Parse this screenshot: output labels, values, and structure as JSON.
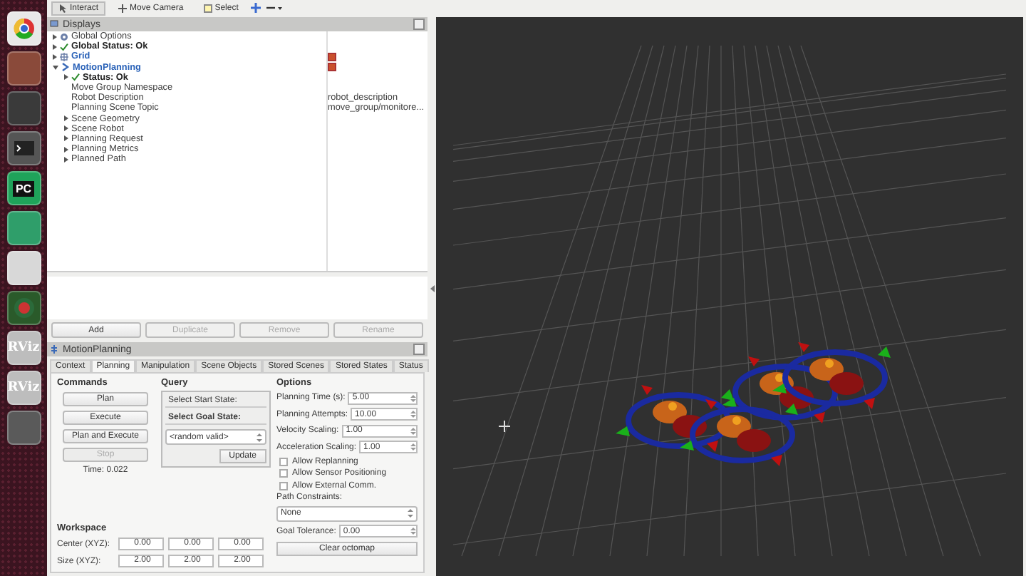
{
  "launcher": [
    {
      "kind": "chrome"
    },
    {
      "kind": "files"
    },
    {
      "kind": "settings"
    },
    {
      "kind": "terminal"
    },
    {
      "kind": "pycharm",
      "label": "PC"
    },
    {
      "kind": "green-app"
    },
    {
      "kind": "editor"
    },
    {
      "kind": "globe"
    },
    {
      "kind": "rviz",
      "label": "RViz"
    },
    {
      "kind": "rviz",
      "label": "RViz"
    },
    {
      "kind": "workspaces"
    }
  ],
  "toolbar": {
    "tools": [
      {
        "kind": "interact",
        "label": "Interact",
        "selected": true
      },
      {
        "kind": "camera",
        "label": "Move Camera",
        "selected": false
      },
      {
        "kind": "select",
        "label": "Select",
        "selected": false
      }
    ]
  },
  "displays": {
    "title": "Displays",
    "items": [
      {
        "label": "Global Options",
        "kind": "options",
        "expanded": false
      },
      {
        "label": "Global Status: Ok",
        "kind": "status",
        "expanded": false
      },
      {
        "label": "Grid",
        "kind": "grid",
        "expanded": false,
        "checked": true
      },
      {
        "label": "MotionPlanning",
        "kind": "plugin",
        "expanded": true,
        "checked": true,
        "children": [
          {
            "label": "Status: Ok",
            "kind": "status",
            "expanded": false
          },
          {
            "label": "Move Group Namespace",
            "kind": "property"
          },
          {
            "label": "Robot Description",
            "kind": "property",
            "value": "robot_description"
          },
          {
            "label": "Planning Scene Topic",
            "kind": "property",
            "value": "move_group/monitore..."
          },
          {
            "label": "Scene Geometry",
            "kind": "group",
            "expanded": false
          },
          {
            "label": "Scene Robot",
            "kind": "group",
            "expanded": false
          },
          {
            "label": "Planning Request",
            "kind": "group",
            "expanded": false
          },
          {
            "label": "Planning Metrics",
            "kind": "group",
            "expanded": false
          },
          {
            "label": "Planned Path",
            "kind": "group",
            "expanded": false
          }
        ]
      }
    ],
    "buttons": [
      {
        "label": "Add",
        "disabled": false
      },
      {
        "label": "Duplicate",
        "disabled": true
      },
      {
        "label": "Remove",
        "disabled": true
      },
      {
        "label": "Rename",
        "disabled": true
      }
    ]
  },
  "motion_planning": {
    "title": "MotionPlanning",
    "tabs": [
      {
        "label": "Context",
        "selected": false
      },
      {
        "label": "Planning",
        "selected": true
      },
      {
        "label": "Manipulation",
        "selected": false
      },
      {
        "label": "Scene Objects",
        "selected": false
      },
      {
        "label": "Stored Scenes",
        "selected": false
      },
      {
        "label": "Stored States",
        "selected": false
      },
      {
        "label": "Status",
        "selected": false
      }
    ],
    "commands": {
      "title": "Commands",
      "buttons": [
        {
          "label": "Plan",
          "disabled": false
        },
        {
          "label": "Execute",
          "disabled": false
        },
        {
          "label": "Plan and Execute",
          "disabled": false
        },
        {
          "label": "Stop",
          "disabled": true
        }
      ],
      "time": "Time: 0.022"
    },
    "query": {
      "title": "Query",
      "sections": [
        {
          "label": "Select Start State:",
          "expanded": false
        },
        {
          "label": "Select Goal State:",
          "expanded": true
        }
      ],
      "goal_state": "<random valid>",
      "update_button": "Update"
    },
    "workspace": {
      "title": "Workspace",
      "rows": [
        {
          "label": "Center (XYZ):",
          "values": [
            "0.00",
            "0.00",
            "0.00"
          ]
        },
        {
          "label": "Size (XYZ):",
          "values": [
            "2.00",
            "2.00",
            "2.00"
          ]
        }
      ]
    },
    "options": {
      "title": "Options",
      "fields": [
        {
          "label": "Planning Time (s):",
          "value": "5.00"
        },
        {
          "label": "Planning Attempts:",
          "value": "10.00"
        },
        {
          "label": "Velocity Scaling:",
          "value": "1.00"
        },
        {
          "label": "Acceleration Scaling:",
          "value": "1.00"
        }
      ],
      "checks": [
        {
          "label": "Allow Replanning",
          "checked": false
        },
        {
          "label": "Allow Sensor Positioning",
          "checked": false
        },
        {
          "label": "Allow External Comm.",
          "checked": false
        }
      ],
      "path_constraints_label": "Path Constraints:",
      "path_constraints": "None",
      "goal_tolerance_label": "Goal Tolerance:",
      "goal_tolerance": "0.00",
      "clear_button": "Clear octomap"
    }
  }
}
